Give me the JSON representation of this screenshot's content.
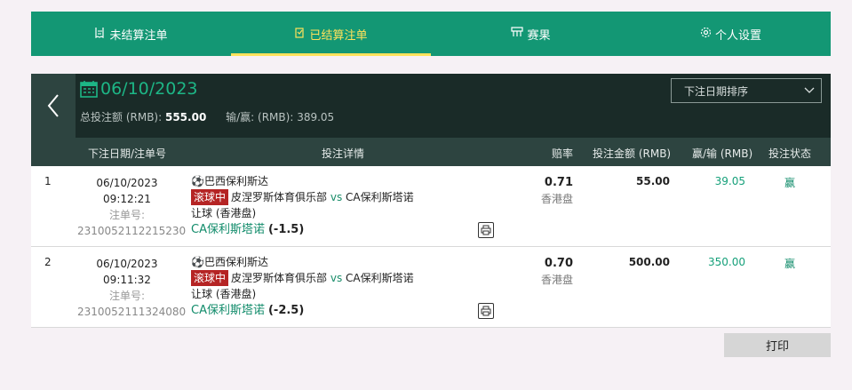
{
  "nav": {
    "tabs": [
      {
        "label": "未结算注单",
        "icon": "receipt-icon"
      },
      {
        "label": "已结算注单",
        "icon": "settled-icon"
      },
      {
        "label": "赛果",
        "icon": "results-icon"
      },
      {
        "label": "个人设置",
        "icon": "gear-icon"
      }
    ],
    "active_index": 1,
    "accent": "#139774",
    "active_color": "#ffe25b"
  },
  "panel": {
    "date": "06/10/2023",
    "total_label": "总投注额 (RMB):",
    "total_value": "555.00",
    "winloss_label": "输/赢: (RMB):",
    "winloss_value": "389.05",
    "sort_select": "下注日期排序"
  },
  "table": {
    "headers": [
      "下注日期/注单号",
      "投注详情",
      "赔率",
      "投注金额 (RMB)",
      "赢/输 (RMB)",
      "投注状态"
    ],
    "rows": [
      {
        "index": "1",
        "datetime": "06/10/2023 09:12:21",
        "ticket_label": "注单号:",
        "ticket_no": "2310052112215230",
        "league": "巴西保利斯达",
        "live": "滚球中",
        "home": "皮涅罗斯体育俱乐部",
        "vs": "vs",
        "away": "CA保利斯塔诺",
        "market": "让球 (香港盘)",
        "selection": "CA保利斯塔诺",
        "handicap": "(-1.5)",
        "odds": "0.71",
        "odds_type": "香港盘",
        "stake": "55.00",
        "winloss": "39.05",
        "status": "赢"
      },
      {
        "index": "2",
        "datetime": "06/10/2023 09:11:32",
        "ticket_label": "注单号:",
        "ticket_no": "2310052111324080",
        "league": "巴西保利斯达",
        "live": "滚球中",
        "home": "皮涅罗斯体育俱乐部",
        "vs": "vs",
        "away": "CA保利斯塔诺",
        "market": "让球 (香港盘)",
        "selection": "CA保利斯塔诺",
        "handicap": "(-2.5)",
        "odds": "0.70",
        "odds_type": "香港盘",
        "stake": "500.00",
        "winloss": "350.00",
        "status": "赢"
      }
    ]
  },
  "print_button": "打印"
}
